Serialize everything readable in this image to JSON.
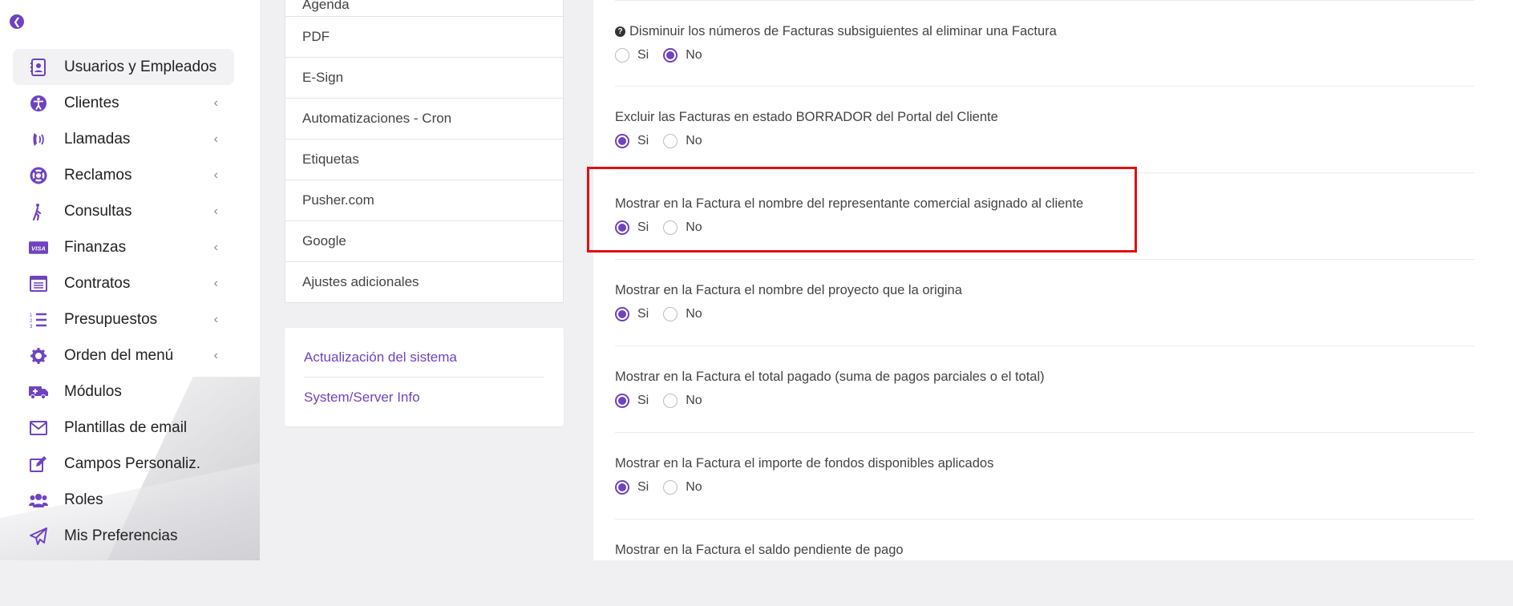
{
  "sidebar": {
    "items": [
      {
        "label": "Usuarios y Empleados",
        "icon": "contact-card-icon",
        "chevron": false,
        "active": true
      },
      {
        "label": "Clientes",
        "icon": "accessibility-icon",
        "chevron": true
      },
      {
        "label": "Llamadas",
        "icon": "phone-volume-icon",
        "chevron": true
      },
      {
        "label": "Reclamos",
        "icon": "life-ring-icon",
        "chevron": true
      },
      {
        "label": "Consultas",
        "icon": "person-walking-icon",
        "chevron": true
      },
      {
        "label": "Finanzas",
        "icon": "visa-card-icon",
        "chevron": true
      },
      {
        "label": "Contratos",
        "icon": "list-alt-icon",
        "chevron": true
      },
      {
        "label": "Presupuestos",
        "icon": "ordered-list-icon",
        "chevron": true
      },
      {
        "label": "Orden del menú",
        "icon": "gear-icon",
        "chevron": true
      },
      {
        "label": "Módulos",
        "icon": "ambulance-icon",
        "chevron": false
      },
      {
        "label": "Plantillas de email",
        "icon": "envelope-icon",
        "chevron": false
      },
      {
        "label": "Campos Personaliz.",
        "icon": "edit-icon",
        "chevron": false
      },
      {
        "label": "Roles",
        "icon": "users-icon",
        "chevron": false
      },
      {
        "label": "Mis Preferencias",
        "icon": "paper-plane-icon",
        "chevron": false
      }
    ]
  },
  "settings_menu": {
    "partial_item": "Agenda",
    "items": [
      "PDF",
      "E-Sign",
      "Automatizaciones - Cron",
      "Etiquetas",
      "Pusher.com",
      "Google",
      "Ajustes adicionales"
    ]
  },
  "system_links": [
    "Actualización del sistema",
    "System/Server Info"
  ],
  "invoice_settings": {
    "yes_label": "Si",
    "no_label": "No",
    "options": [
      {
        "question": "Disminuir los números de Facturas subsiguientes al eliminar una Factura",
        "help_icon": true,
        "value": "No"
      },
      {
        "question": "Excluir las Facturas en estado BORRADOR del Portal del Cliente",
        "value": "Si"
      },
      {
        "question": "Mostrar en la Factura el nombre del representante comercial asignado al cliente",
        "value": "Si",
        "highlighted": true
      },
      {
        "question": "Mostrar en la Factura el nombre del proyecto que la origina",
        "value": "Si"
      },
      {
        "question": "Mostrar en la Factura el total pagado (suma de pagos parciales o el total)",
        "value": "Si"
      },
      {
        "question": "Mostrar en la Factura el importe de fondos disponibles aplicados",
        "value": "Si"
      },
      {
        "question": "Mostrar en la Factura el saldo pendiente de pago",
        "value": null
      }
    ]
  },
  "colors": {
    "accent": "#6f42c1",
    "highlight_border": "#e01010"
  }
}
